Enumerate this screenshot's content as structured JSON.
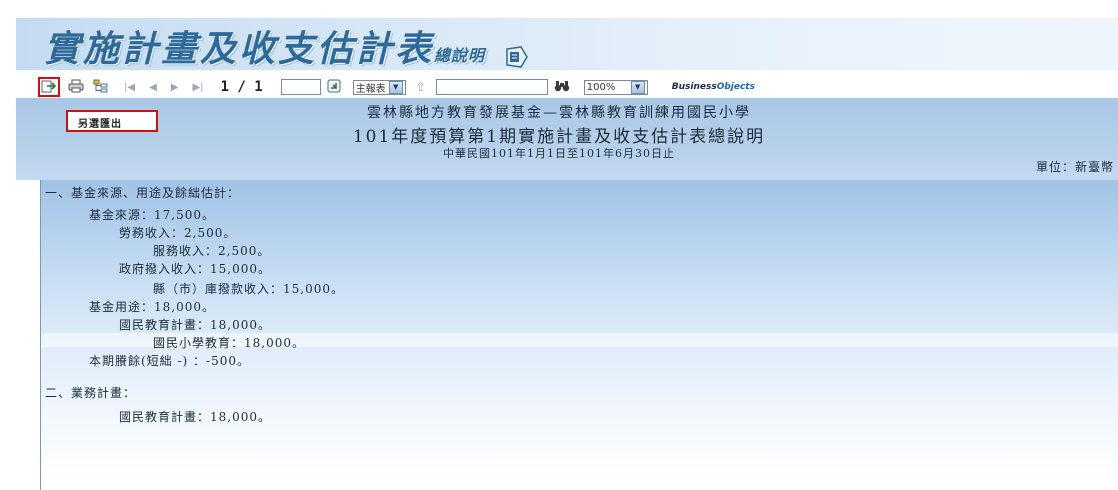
{
  "banner": {
    "title": "實施計畫及收支估計表",
    "title_suffix": "總說明"
  },
  "toolbar": {
    "page_indicator": "1 / 1",
    "report_select": "主報表",
    "zoom": "100%",
    "brand_prefix": "Business",
    "brand_suffix": "Objects"
  },
  "report": {
    "export_label": "另選匯出",
    "header_line1": "雲林縣地方教育發展基金—雲林縣教育訓練用國民小學",
    "header_line2": "101年度預算第1期實施計畫及收支估計表總說明",
    "header_line3": "中華民國101年1月1日至101年6月30日止",
    "unit": "單位：新臺幣",
    "lines": [
      "一、基金來源、用途及餘絀估計：",
      "基金來源：17,500。",
      "勞務收入：2,500。",
      "服務收入：2,500。",
      "政府撥入收入：15,000。",
      "縣（市）庫撥款收入：15,000。",
      "基金用途：18,000。",
      "國民教育計畫：18,000。",
      "國民小學教育：18,000。",
      "本期賸餘(短絀 -) ：-500。",
      "二、業務計畫：",
      "國民教育計畫：18,000。"
    ]
  },
  "colors": {
    "banner_text": "#2d6a99",
    "header_band": "#a8c7e6",
    "highlight_border": "#cc1111"
  },
  "icons": [
    "export-icon",
    "print-icon",
    "group-tree-icon",
    "first-page-icon",
    "prev-page-icon",
    "next-page-icon",
    "last-page-icon",
    "go-page-icon",
    "drill-up-icon",
    "binoculars-icon",
    "dropdown-icon"
  ]
}
